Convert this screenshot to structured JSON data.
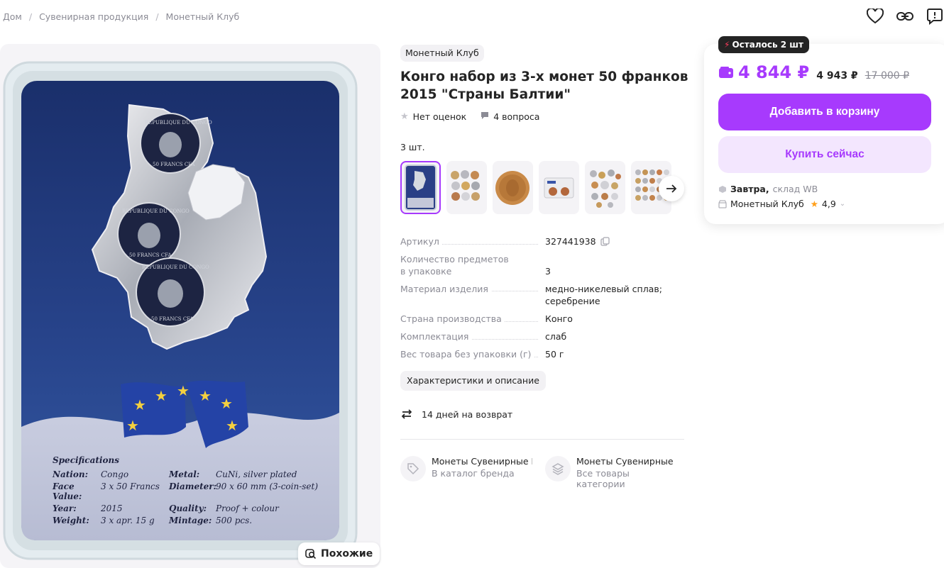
{
  "breadcrumb": [
    "Дом",
    "Сувенирная продукция",
    "Монетный Клуб"
  ],
  "seller_tag": "Монетный Клуб",
  "title": "Конго набор из 3-х монет 50 франков 2015 \"Страны Балтии\"",
  "rating_text": "Нет оценок",
  "questions_text": "4 вопроса",
  "qty_label": "3 шт.",
  "specs": [
    {
      "k": "Артикул",
      "v": "327441938"
    },
    {
      "k": "Количество предметов в упаковке",
      "v": "3"
    },
    {
      "k": "Материал изделия",
      "v": "медно-никелевый сплав; серебрение"
    },
    {
      "k": "Страна производства",
      "v": "Конго"
    },
    {
      "k": "Комплектация",
      "v": "слаб"
    },
    {
      "k": "Вес товара без упаковки (г)",
      "v": "50 г"
    }
  ],
  "desc_button": "Характеристики и описание",
  "returns": "14 дней на возврат",
  "brand_links": [
    {
      "t1": "Монеты Сувенирные М",
      "t2": "В каталог бренда"
    },
    {
      "t1": "Монеты Сувенирные",
      "t2": "Все товары категории"
    }
  ],
  "similar_button": "Похожие",
  "buy": {
    "stock": "Осталось 2 шт",
    "price": "4 844 ₽",
    "price_alt": "4 943 ₽",
    "price_old": "17 000 ₽",
    "cart_button": "Добавить в корзину",
    "buy_button": "Купить сейчас",
    "delivery_day": "Завтра,",
    "delivery_where": "склад WB",
    "seller": "Монетный Клуб",
    "seller_rating": "4,9"
  },
  "slab_specs": {
    "heading": "Specifications",
    "rows": [
      [
        "Nation:",
        "Congo",
        "Metal:",
        "CuNi, silver plated"
      ],
      [
        "Face Value:",
        "3 x 50 Francs",
        "Diameter:",
        "90 x 60 mm (3-coin-set)"
      ],
      [
        "Year:",
        "2015",
        "Quality:",
        "Proof + colour"
      ],
      [
        "Weight:",
        "3 x apr. 15 g",
        "Mintage:",
        "500 pcs."
      ]
    ]
  },
  "colors": {
    "accent": "#a73afd",
    "accent_light": "#f3e6fe",
    "dark": "#242424",
    "muted": "#8b8b95"
  }
}
